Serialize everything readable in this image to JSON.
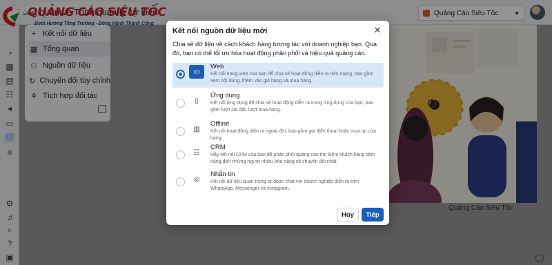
{
  "header": {
    "page_title": "Tổng quan về Trình quản lý sự kiện",
    "account_name": "Quảng Cáo Siêu Tốc"
  },
  "watermark": {
    "brand": "QUẢNG CÁO SIÊU TỐC",
    "tagline": "Định Hướng Tăng Trưởng - Đồng Hành Thành Công"
  },
  "sidebar": {
    "items": [
      {
        "label": "Kết nối dữ liệu",
        "icon": "plus-icon"
      },
      {
        "label": "Tổng quan",
        "icon": "grid-icon"
      },
      {
        "label": "Nguồn dữ liệu",
        "icon": "people-icon"
      },
      {
        "label": "Chuyển đổi tùy chỉnh",
        "icon": "refresh-icon"
      },
      {
        "label": "Tích hợp đối tác",
        "icon": "partner-icon"
      }
    ]
  },
  "hero": {
    "caption": "Quảng Cáo Siêu Tốc"
  },
  "modal": {
    "title": "Kết nối nguồn dữ liệu mới",
    "description": "Chia sẻ dữ liệu về cách khách hàng tương tác với doanh nghiệp bạn. Qua đó, bạn có thể tối ưu hóa hoạt động phân phối và hiệu quả quảng cáo.",
    "options": [
      {
        "title": "Web",
        "desc": "Kết nối trang web của bạn để chia sẻ hoạt động diễn ra trên mạng, bao gồm xem nội dung, thêm vào giỏ hàng và mua hàng.",
        "icon": "laptop-icon",
        "selected": true
      },
      {
        "title": "Ứng dụng",
        "desc": "Kết nối ứng dụng để chia sẻ hoạt động diễn ra trong ứng dụng của bạn, bao gồm lượt cài đặt, lượt mua hàng.",
        "icon": "mobile-icon",
        "selected": false
      },
      {
        "title": "Offline",
        "desc": "Kết nối hoạt động diễn ra ngoài đời, bao gồm gọi điện thoại hoặc mua tại cửa hàng.",
        "icon": "store-icon",
        "selected": false
      },
      {
        "title": "CRM",
        "desc": "Hãy kết nối CRM của bạn để phân phối quảng cáo tìm kiếm khách hàng tiềm năng đến những người nhiều khả năng sẽ chuyển đổi nhất.",
        "icon": "crm-icon",
        "selected": false
      },
      {
        "title": "Nhắn tin",
        "desc": "Kết nối dữ liệu quan trọng từ đoạn chat với doanh nghiệp diễn ra trên WhatsApp, Messenger và Instagram.",
        "icon": "chat-icon",
        "selected": false
      }
    ],
    "cancel_label": "Hủy",
    "next_label": "Tiếp"
  },
  "colors": {
    "primary": "#1b5fb5",
    "selected_bg": "#d9e6f8",
    "brand_red": "#d6202a"
  }
}
